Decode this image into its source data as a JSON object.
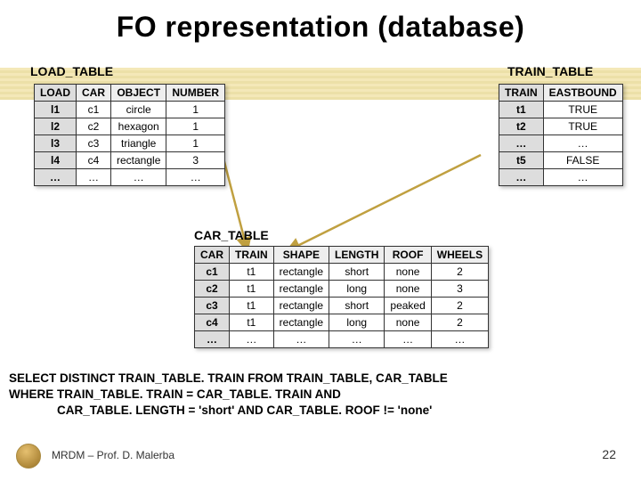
{
  "title": "FO representation (database)",
  "labels": {
    "load": "LOAD_TABLE",
    "train": "TRAIN_TABLE",
    "car": "CAR_TABLE"
  },
  "load_table": {
    "headers": [
      "LOAD",
      "CAR",
      "OBJECT",
      "NUMBER"
    ],
    "rows": [
      [
        "l1",
        "c1",
        "circle",
        "1"
      ],
      [
        "l2",
        "c2",
        "hexagon",
        "1"
      ],
      [
        "l3",
        "c3",
        "triangle",
        "1"
      ],
      [
        "l4",
        "c4",
        "rectangle",
        "3"
      ],
      [
        "…",
        "…",
        "…",
        "…"
      ]
    ]
  },
  "train_table": {
    "headers": [
      "TRAIN",
      "EASTBOUND"
    ],
    "rows": [
      [
        "t1",
        "TRUE"
      ],
      [
        "t2",
        "TRUE"
      ],
      [
        "…",
        "…"
      ],
      [
        "t5",
        "FALSE"
      ],
      [
        "…",
        "…"
      ]
    ]
  },
  "car_table": {
    "headers": [
      "CAR",
      "TRAIN",
      "SHAPE",
      "LENGTH",
      "ROOF",
      "WHEELS"
    ],
    "rows": [
      [
        "c1",
        "t1",
        "rectangle",
        "short",
        "none",
        "2"
      ],
      [
        "c2",
        "t1",
        "rectangle",
        "long",
        "none",
        "3"
      ],
      [
        "c3",
        "t1",
        "rectangle",
        "short",
        "peaked",
        "2"
      ],
      [
        "c4",
        "t1",
        "rectangle",
        "long",
        "none",
        "2"
      ],
      [
        "…",
        "…",
        "…",
        "…",
        "…",
        "…"
      ]
    ]
  },
  "sql": {
    "line1": "SELECT DISTINCT TRAIN_TABLE. TRAIN FROM TRAIN_TABLE, CAR_TABLE",
    "line2": "WHERE TRAIN_TABLE. TRAIN = CAR_TABLE. TRAIN AND",
    "line3": "CAR_TABLE. LENGTH = 'short' AND CAR_TABLE. ROOF != 'none'"
  },
  "footer": {
    "text": "MRDM – Prof. D. Malerba",
    "page": "22"
  }
}
